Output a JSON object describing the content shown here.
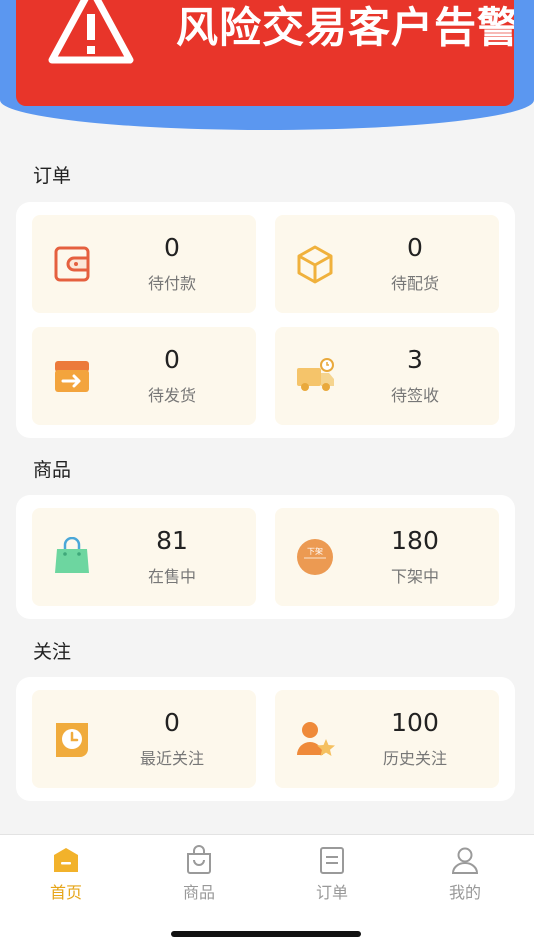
{
  "banner": {
    "text": "风险交易客户告警提示",
    "icon": "warning-icon"
  },
  "sections": {
    "orders": {
      "title": "订单",
      "tiles": [
        {
          "value": "0",
          "label": "待付款",
          "icon": "wallet-icon"
        },
        {
          "value": "0",
          "label": "待配货",
          "icon": "box-icon"
        },
        {
          "value": "0",
          "label": "待发货",
          "icon": "ship-box-icon"
        },
        {
          "value": "3",
          "label": "待签收",
          "icon": "delivery-truck-icon"
        }
      ]
    },
    "goods": {
      "title": "商品",
      "tiles": [
        {
          "value": "81",
          "label": "在售中",
          "icon": "shopping-bag-icon"
        },
        {
          "value": "180",
          "label": "下架中",
          "icon": "off-shelf-badge-icon",
          "badge_text": "下架"
        }
      ]
    },
    "follow": {
      "title": "关注",
      "tiles": [
        {
          "value": "0",
          "label": "最近关注",
          "icon": "clock-icon"
        },
        {
          "value": "100",
          "label": "历史关注",
          "icon": "user-star-icon"
        }
      ]
    }
  },
  "tabbar": {
    "tabs": [
      {
        "label": "首页",
        "icon": "home-icon",
        "active": true
      },
      {
        "label": "商品",
        "icon": "bag-icon",
        "active": false
      },
      {
        "label": "订单",
        "icon": "order-list-icon",
        "active": false
      },
      {
        "label": "我的",
        "icon": "profile-icon",
        "active": false
      }
    ]
  },
  "colors": {
    "banner_red": "#e8352a",
    "banner_blue": "#5b97f0",
    "tile_bg": "#fdf8ec",
    "accent": "#e6a519"
  }
}
